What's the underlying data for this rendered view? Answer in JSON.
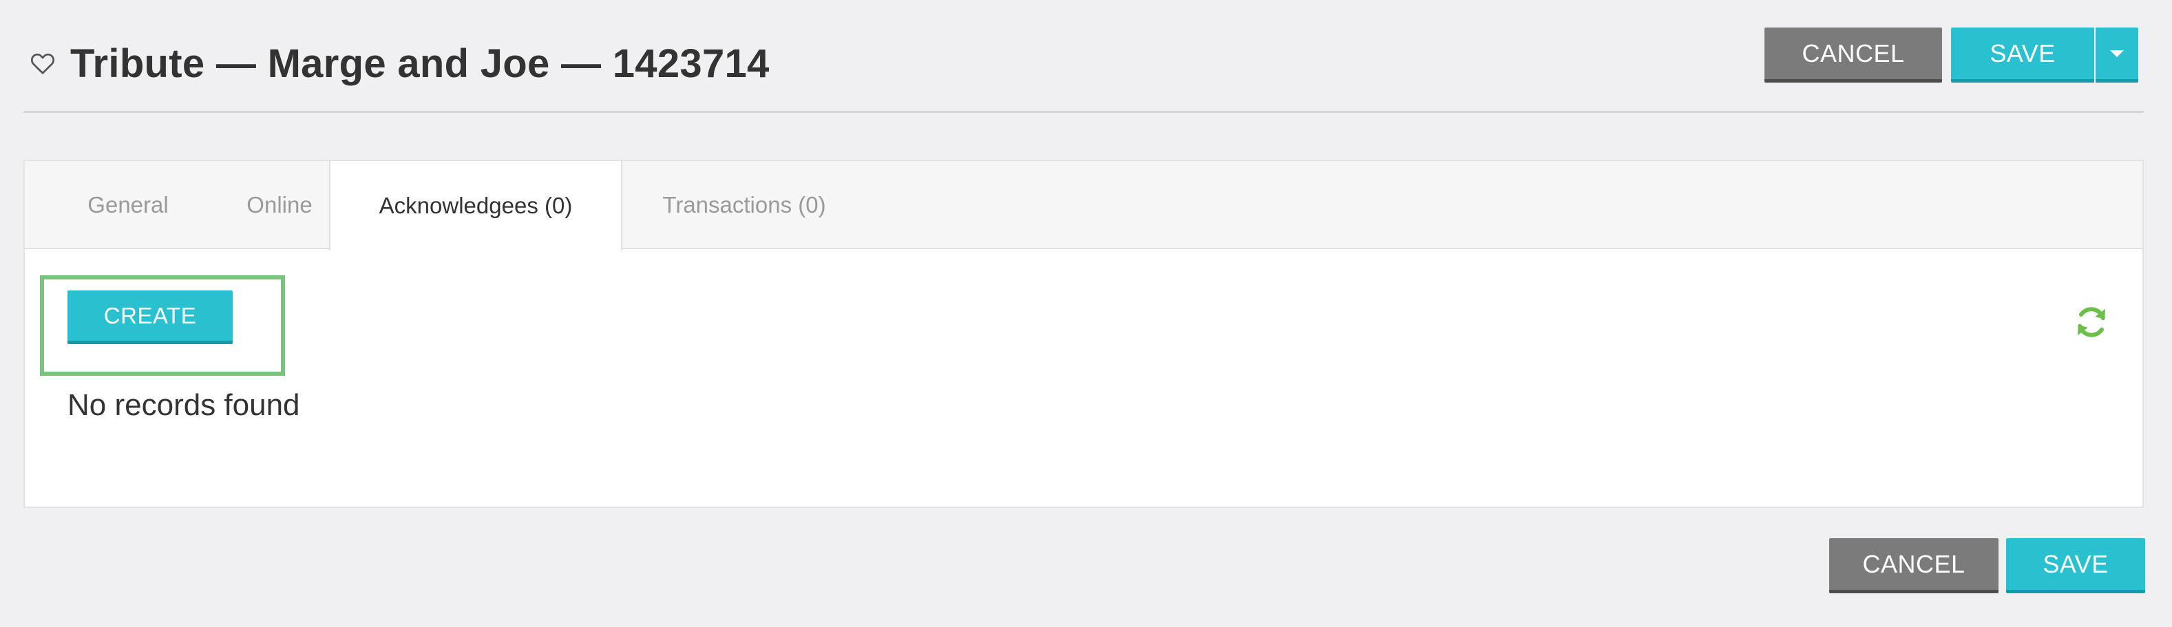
{
  "header": {
    "title": "Tribute — Marge and Joe — 1423714",
    "icon": "heart-outline-icon",
    "cancel_label": "CANCEL",
    "save_label": "SAVE",
    "dropdown_icon": "caret-down-icon"
  },
  "tabs": [
    {
      "label": "General",
      "active": false
    },
    {
      "label": "Online",
      "active": false
    },
    {
      "label": "Acknowledgees (0)",
      "active": true
    },
    {
      "label": "Transactions (0)",
      "active": false
    }
  ],
  "content": {
    "create_label": "CREATE",
    "empty_message": "No records found",
    "refresh_icon": "refresh-icon"
  },
  "footer": {
    "cancel_label": "CANCEL",
    "save_label": "SAVE"
  },
  "colors": {
    "primary": "#29c0d0",
    "secondary": "#7b7b7b",
    "highlight": "#7ac27d",
    "refresh": "#6cc04a",
    "background": "#f0f0f2"
  }
}
